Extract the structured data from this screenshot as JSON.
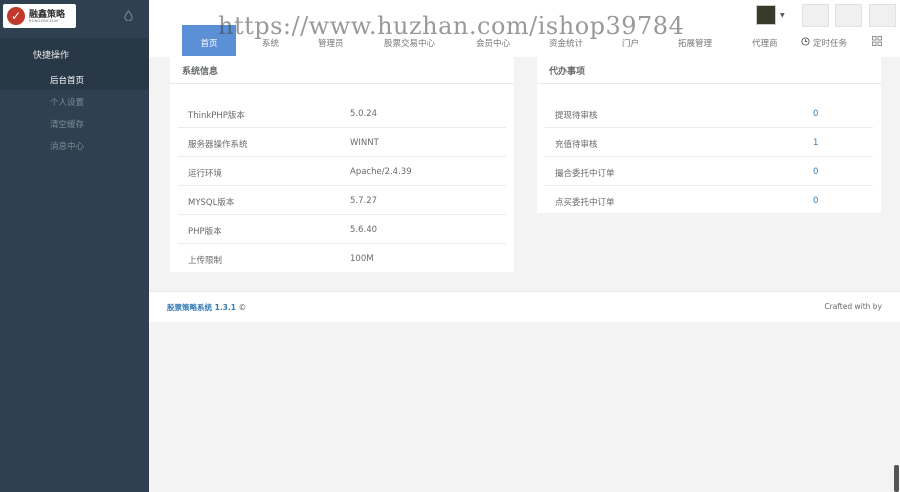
{
  "brand": {
    "name": "融鑫策略",
    "sub": "RONGXINCELVE"
  },
  "sidebar": {
    "header": "快捷操作",
    "items": [
      {
        "label": "后台首页"
      },
      {
        "label": "个人设置"
      },
      {
        "label": "清空缓存"
      },
      {
        "label": "消息中心"
      }
    ]
  },
  "nav": {
    "tabs": [
      {
        "label": "首页"
      },
      {
        "label": "系统"
      },
      {
        "label": "管理员"
      },
      {
        "label": "股票交易中心"
      },
      {
        "label": "会员中心"
      },
      {
        "label": "资金统计"
      },
      {
        "label": "门户"
      },
      {
        "label": "拓展管理"
      },
      {
        "label": "代理商"
      },
      {
        "label": "定时任务"
      }
    ]
  },
  "watermark": "https://www.huzhan.com/ishop39784",
  "system_info": {
    "title": "系统信息",
    "rows": [
      {
        "key": "ThinkPHP版本",
        "value": "5.0.24"
      },
      {
        "key": "服务器操作系统",
        "value": "WINNT"
      },
      {
        "key": "运行环境",
        "value": "Apache/2.4.39"
      },
      {
        "key": "MYSQL版本",
        "value": "5.7.27"
      },
      {
        "key": "PHP版本",
        "value": "5.6.40"
      },
      {
        "key": "上传限制",
        "value": "100M"
      }
    ]
  },
  "todo": {
    "title": "代办事项",
    "rows": [
      {
        "key": "提现待审核",
        "value": "0"
      },
      {
        "key": "充值待审核",
        "value": "1"
      },
      {
        "key": "撮合委托中订单",
        "value": "0"
      },
      {
        "key": "点买委托中订单",
        "value": "0"
      }
    ]
  },
  "footer": {
    "left": "股票策略系统 1.3.1",
    "copyright": "©",
    "right": "Crafted with    by"
  },
  "colors": {
    "sidebar": "#2f4050",
    "accent": "#5b8fd6",
    "link": "#337ab7"
  }
}
